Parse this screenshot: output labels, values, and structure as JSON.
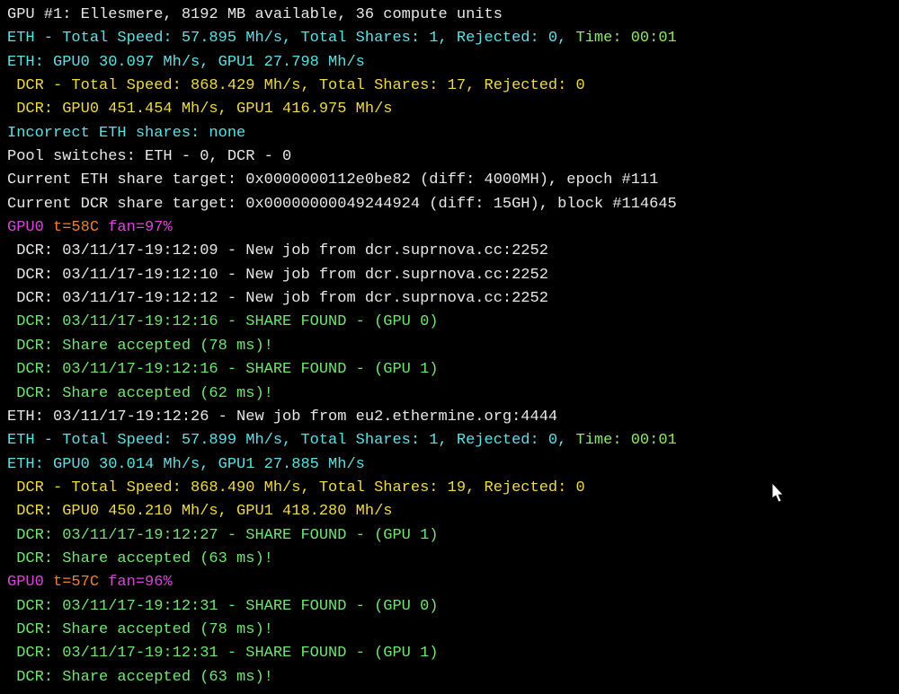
{
  "gpu1_info": "GPU #1: Ellesmere, 8192 MB available, 36 compute units",
  "eth_total_1": "ETH - Total Speed: 57.895 Mh/s, Total Shares: 1, Rejected: 0, ",
  "eth_time_1": "Time: 00:01",
  "eth_per_gpu_1": "ETH: GPU0 30.097 Mh/s, GPU1 27.798 Mh/s",
  "dcr_total_1": " DCR - Total Speed: 868.429 Mh/s, Total Shares: 17, Rejected: 0",
  "dcr_per_gpu_1": " DCR: GPU0 451.454 Mh/s, GPU1 416.975 Mh/s",
  "incorrect_eth": "Incorrect ETH shares: none",
  "pool_switches": "Pool switches: ETH - 0, DCR - 0",
  "eth_target": "Current ETH share target: 0x0000000112e0be82 (diff: 4000MH), epoch #111",
  "dcr_target": "Current DCR share target: 0x00000000049244924 (diff: 15GH), block #114645",
  "gpu_status_1_label": "GPU0 ",
  "gpu_status_1_temp": "t=58C ",
  "gpu_status_1_fan": "fan=97%",
  "blank": "",
  "dcr_job_1": " DCR: 03/11/17-19:12:09 - New job from dcr.suprnova.cc:2252",
  "dcr_job_2": " DCR: 03/11/17-19:12:10 - New job from dcr.suprnova.cc:2252",
  "dcr_job_3": " DCR: 03/11/17-19:12:12 - New job from dcr.suprnova.cc:2252",
  "dcr_found_1": " DCR: 03/11/17-19:12:16 - SHARE FOUND - (GPU 0)",
  "dcr_accept_1": " DCR: Share accepted (78 ms)!",
  "dcr_found_2": " DCR: 03/11/17-19:12:16 - SHARE FOUND - (GPU 1)",
  "dcr_accept_2": " DCR: Share accepted (62 ms)!",
  "eth_job_1": "ETH: 03/11/17-19:12:26 - New job from eu2.ethermine.org:4444",
  "eth_total_2": "ETH - Total Speed: 57.899 Mh/s, Total Shares: 1, Rejected: 0, ",
  "eth_time_2": "Time: 00:01",
  "eth_per_gpu_2": "ETH: GPU0 30.014 Mh/s, GPU1 27.885 Mh/s",
  "dcr_total_2": " DCR - Total Speed: 868.490 Mh/s, Total Shares: 19, Rejected: 0",
  "dcr_per_gpu_2": " DCR: GPU0 450.210 Mh/s, GPU1 418.280 Mh/s",
  "dcr_found_3": " DCR: 03/11/17-19:12:27 - SHARE FOUND - (GPU 1)",
  "dcr_accept_3": " DCR: Share accepted (63 ms)!",
  "gpu_status_2_label": "GPU0 ",
  "gpu_status_2_temp": "t=57C ",
  "gpu_status_2_fan": "fan=96%",
  "dcr_found_4": " DCR: 03/11/17-19:12:31 - SHARE FOUND - (GPU 0)",
  "dcr_accept_4": " DCR: Share accepted (78 ms)!",
  "dcr_found_5": " DCR: 03/11/17-19:12:31 - SHARE FOUND - (GPU 1)",
  "dcr_accept_5": " DCR: Share accepted (63 ms)!"
}
